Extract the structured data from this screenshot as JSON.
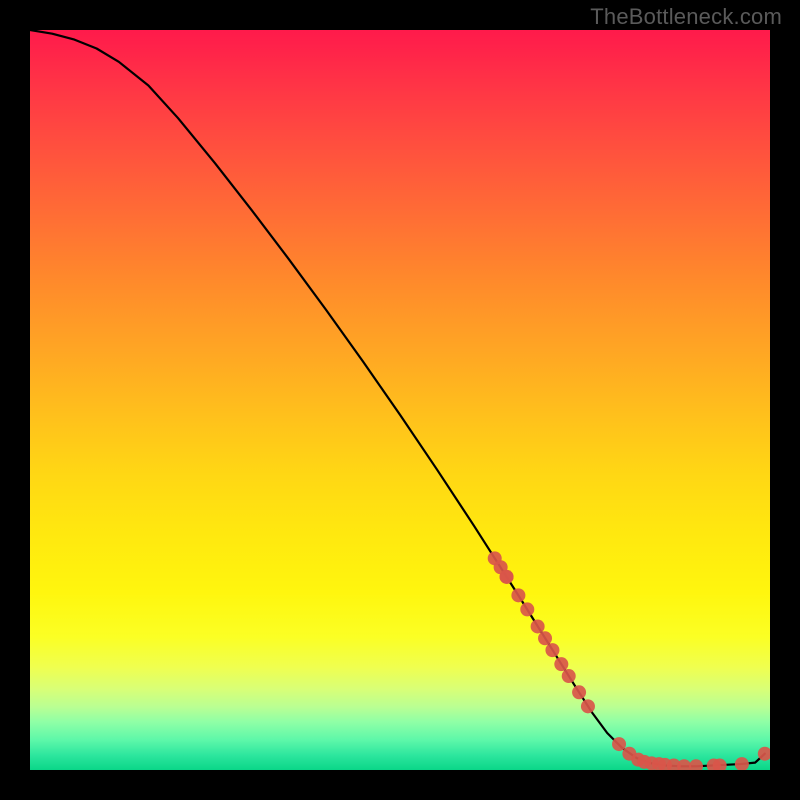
{
  "watermark": "TheBottleneck.com",
  "chart_data": {
    "type": "line",
    "title": "",
    "xlabel": "",
    "ylabel": "",
    "xlim": [
      0,
      100
    ],
    "ylim": [
      0,
      100
    ],
    "grid": false,
    "legend": false,
    "curve": {
      "name": "curve",
      "x": [
        0,
        3,
        6,
        9,
        12,
        16,
        20,
        25,
        30,
        35,
        40,
        45,
        50,
        55,
        60,
        63,
        66,
        69,
        72,
        74,
        76,
        78,
        80,
        82,
        84,
        86,
        88,
        90,
        92,
        94,
        96,
        98,
        99.3
      ],
      "y": [
        100,
        99.5,
        98.7,
        97.5,
        95.7,
        92.5,
        88.1,
        82.0,
        75.6,
        69.0,
        62.2,
        55.2,
        48.0,
        40.6,
        33.0,
        28.3,
        23.6,
        18.8,
        14.0,
        10.8,
        7.7,
        5.0,
        3.0,
        1.6,
        0.9,
        0.6,
        0.5,
        0.5,
        0.6,
        0.7,
        0.8,
        1.0,
        2.2
      ]
    },
    "markers": {
      "name": "points",
      "color": "#d9564a",
      "x": [
        62.8,
        63.6,
        64.4,
        64.4,
        66.0,
        67.2,
        68.6,
        69.6,
        70.6,
        71.8,
        72.8,
        74.2,
        75.4,
        79.6,
        81.0,
        82.2,
        83.0,
        84.0,
        85.0,
        85.8,
        87.0,
        88.4,
        90.0,
        92.4,
        93.2,
        96.2,
        99.3
      ],
      "y": [
        28.6,
        27.4,
        26.1,
        26.1,
        23.6,
        21.7,
        19.4,
        17.8,
        16.2,
        14.3,
        12.7,
        10.5,
        8.6,
        3.5,
        2.2,
        1.4,
        1.1,
        0.9,
        0.8,
        0.7,
        0.6,
        0.5,
        0.5,
        0.6,
        0.6,
        0.8,
        2.2
      ]
    }
  }
}
